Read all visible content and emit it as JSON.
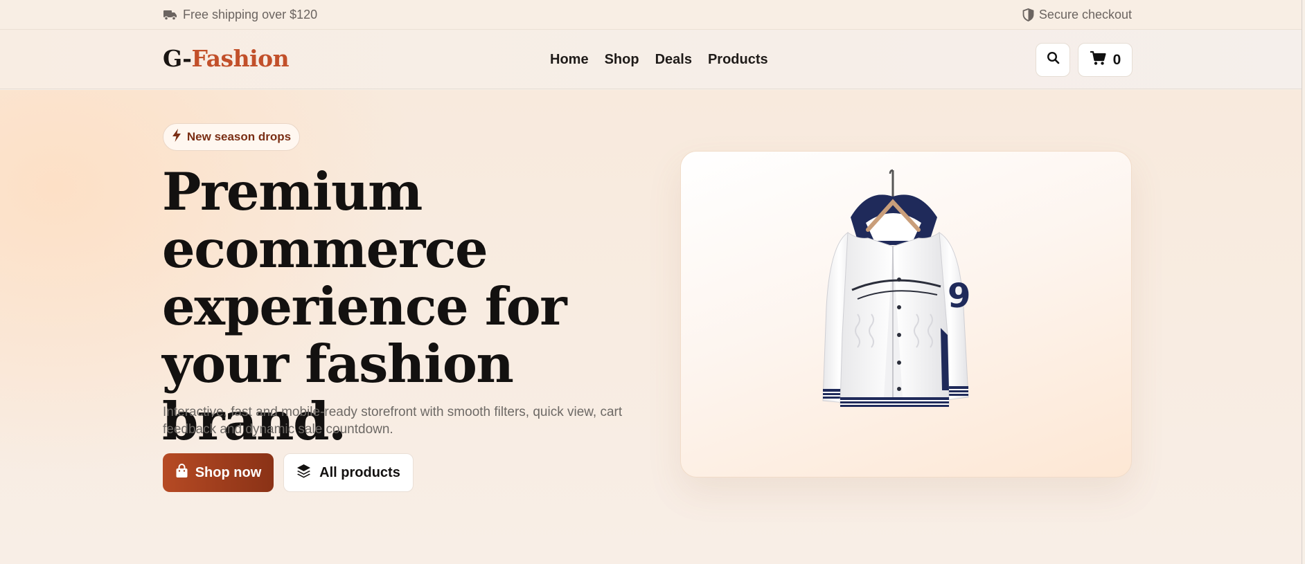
{
  "topbar": {
    "shipping_text": "Free shipping over $120",
    "secure_text": "Secure checkout",
    "shipping_icon": "truck-icon",
    "secure_icon": "shield-icon"
  },
  "header": {
    "logo_part1": "G-",
    "logo_part2": "Fashion",
    "nav": [
      {
        "label": "Home"
      },
      {
        "label": "Shop"
      },
      {
        "label": "Deals"
      },
      {
        "label": "Products"
      }
    ],
    "search_icon": "search-icon",
    "cart_icon": "cart-icon",
    "cart_count": "0"
  },
  "hero": {
    "badge_text": "New season drops",
    "badge_icon": "bolt-icon",
    "headline": "Premium ecommerce experience for your fashion brand.",
    "subtitle": "Interactive, fast and mobile-ready storefront with smooth filters, quick view, cart feedback and dynamic sale countdown.",
    "primary_button": "Shop now",
    "primary_icon": "shopping-bag-icon",
    "secondary_button": "All products",
    "secondary_icon": "layers-icon",
    "image_alt": "jacket-product-image"
  },
  "colors": {
    "accent": "#c2502a",
    "accent_dark": "#8a3216",
    "text": "#131110",
    "muted": "#6d6965",
    "background": "#f8eee4"
  }
}
